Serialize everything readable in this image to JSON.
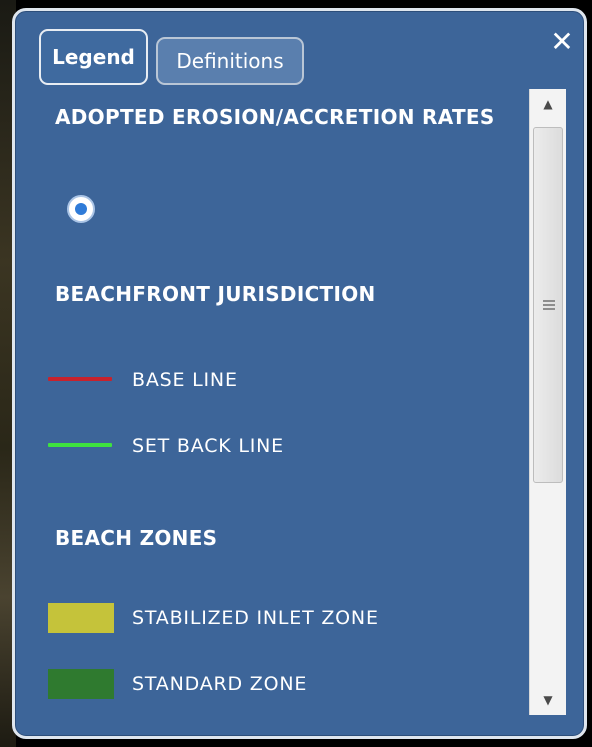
{
  "tabs": {
    "legend_label": "Legend",
    "definitions_label": "Definitions"
  },
  "close_glyph": "✕",
  "sections": {
    "rates": {
      "heading": "ADOPTED EROSION/ACCRETION RATES",
      "layer_selected": true
    },
    "jurisdiction": {
      "heading": "BEACHFRONT JURISDICTION",
      "items": [
        {
          "label": "BASE LINE",
          "color": "#c8222c"
        },
        {
          "label": "SET BACK LINE",
          "color": "#3ee23e"
        }
      ]
    },
    "zones": {
      "heading": "BEACH ZONES",
      "items": [
        {
          "label": "STABILIZED INLET ZONE",
          "color": "#c5c33a"
        },
        {
          "label": "STANDARD ZONE",
          "color": "#2f7a2f"
        }
      ]
    }
  },
  "scrollbar": {
    "up_glyph": "▲",
    "down_glyph": "▼"
  },
  "colors": {
    "panel_background": "#3d6599",
    "panel_border": "#dfe6ee",
    "text": "#ffffff"
  },
  "icons": [
    "close-icon",
    "radio-selected-icon",
    "scroll-up-icon",
    "scroll-down-icon",
    "scroll-grip-icon"
  ]
}
